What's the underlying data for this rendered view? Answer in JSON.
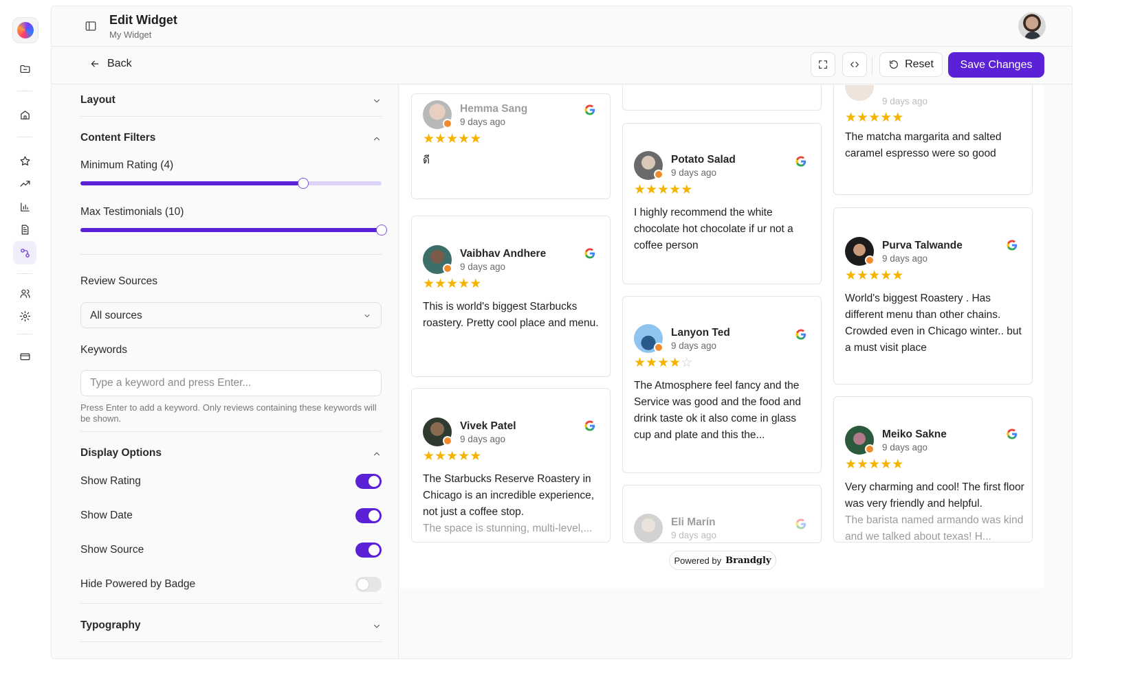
{
  "header": {
    "title": "Edit Widget",
    "subtitle": "My Widget"
  },
  "actions": {
    "back": "Back",
    "reset": "Reset",
    "save": "Save Changes"
  },
  "settings": {
    "layout": "Layout",
    "content_filters": "Content Filters",
    "min_rating_label": "Minimum Rating (4)",
    "min_rating_fraction": 0.74,
    "max_testimonials_label": "Max Testimonials (10)",
    "max_testimonials_fraction": 1.0,
    "review_sources_label": "Review Sources",
    "review_sources_value": "All sources",
    "keywords_label": "Keywords",
    "keywords_placeholder": "Type a keyword and press Enter...",
    "keywords_hint": "Press Enter to add a keyword. Only reviews containing these keywords will be shown.",
    "display_options": "Display Options",
    "show_rating": "Show Rating",
    "show_date": "Show Date",
    "show_source": "Show Source",
    "hide_powered": "Hide Powered by Badge",
    "typography": "Typography",
    "toggles": {
      "show_rating": true,
      "show_date": true,
      "show_source": true,
      "hide_powered": false
    }
  },
  "reviews": [
    {
      "name": "Hemma Sang",
      "date": "9 days ago",
      "rating": 5,
      "text": "ดี",
      "source": "google"
    },
    {
      "name": "Vaibhav Andhere",
      "date": "9 days ago",
      "rating": 5,
      "text": "This is world's biggest Starbucks roastery. Pretty cool place and menu.",
      "source": "google"
    },
    {
      "name": "Vivek Patel",
      "date": "9 days ago",
      "rating": 5,
      "text": "The Starbucks Reserve Roastery in Chicago is an incredible experience, not just a coffee stop.",
      "text_fade": "The space is stunning, multi-level,...",
      "source": "google"
    },
    {
      "name": "Potato Salad",
      "date": "9 days ago",
      "rating": 5,
      "text": "I highly recommend the white chocolate hot chocolate if ur not a coffee person",
      "source": "google"
    },
    {
      "name": "Lanyon Ted",
      "date": "9 days ago",
      "rating": 4,
      "text": "The Atmosphere feel fancy and the Service was good and the food and drink taste ok it also come in glass cup and plate and this the...",
      "source": "google"
    },
    {
      "name": "Eli Marín",
      "date": "9 days ago",
      "rating": 5,
      "text": "",
      "source": "google"
    },
    {
      "name": "",
      "date": "9 days ago",
      "rating": 5,
      "text": "The matcha margarita and salted caramel espresso were so good",
      "source": "google"
    },
    {
      "name": "Purva Talwande",
      "date": "9 days ago",
      "rating": 5,
      "text": "World's biggest Roastery . Has different menu than other chains. Crowded even in Chicago winter.. but a must visit place",
      "source": "google"
    },
    {
      "name": "Meiko Sakne",
      "date": "9 days ago",
      "rating": 5,
      "text": "Very charming and cool! The first floor was very friendly and helpful.",
      "text_fade": "The barista named armando was kind and we talked about texas! H...",
      "source": "google"
    }
  ],
  "powered_by": {
    "label": "Powered by",
    "brand": "Brandgly"
  },
  "icons": [
    "folder-icon",
    "home-icon",
    "star-icon",
    "trending-icon",
    "bar-chart-icon",
    "document-icon",
    "integrations-icon",
    "users-icon",
    "gear-icon",
    "credit-card-icon",
    "sidebar-toggle-icon",
    "fullscreen-icon",
    "code-icon",
    "reset-icon",
    "arrow-left-icon",
    "chevron-down-icon",
    "chevron-up-icon",
    "google-icon"
  ],
  "colors": {
    "accent": "#5b21d6",
    "star": "#f5b301"
  }
}
